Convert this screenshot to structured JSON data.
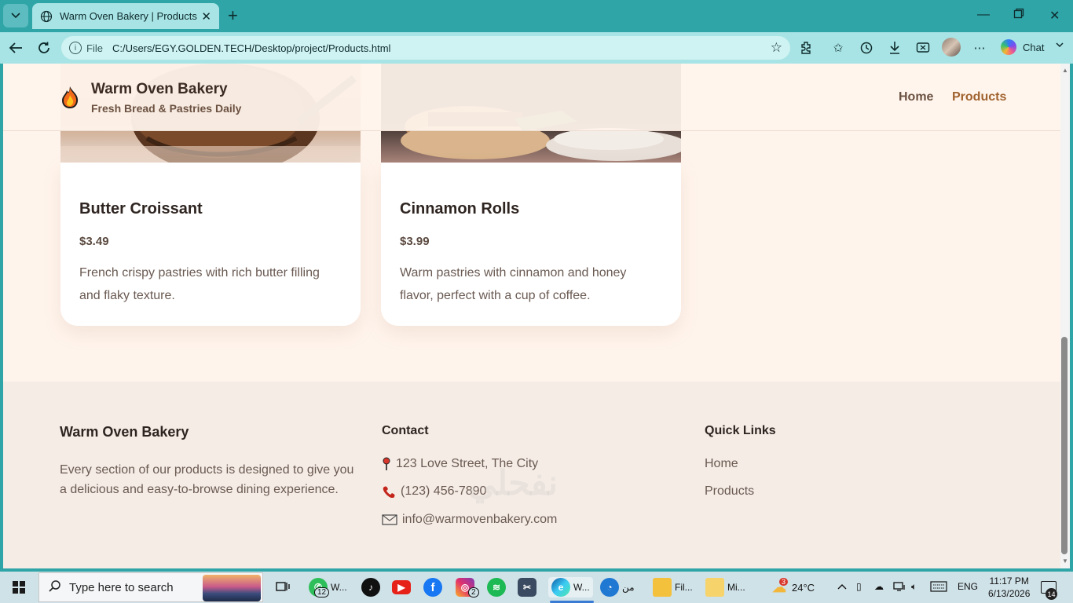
{
  "browser": {
    "tab_title": "Warm Oven Bakery | Products",
    "address_scheme": "File",
    "address_url": "C:/Users/EGY.GOLDEN.TECH/Desktop/project/Products.html",
    "chat_label": "Chat",
    "tab_bg": "#a8e4e5",
    "frame_bg": "#2fa5a8"
  },
  "site": {
    "brand_name": "Warm Oven Bakery",
    "brand_tagline": "Fresh Bread & Pastries Daily",
    "nav": [
      {
        "label": "Home",
        "active": false,
        "color": "#6b5141"
      },
      {
        "label": "Products",
        "active": true,
        "color": "#a0622e"
      }
    ]
  },
  "products": [
    {
      "name": "Butter Croissant",
      "price": "$3.49",
      "description": "French crispy pastries with rich butter filling and flaky texture."
    },
    {
      "name": "Cinnamon Rolls",
      "price": "$3.99",
      "description": "Warm pastries with cinnamon and honey flavor, perfect with a cup of coffee."
    }
  ],
  "footer": {
    "about_title": "Warm Oven Bakery",
    "about_text": "Every section of our products is designed to give you a delicious and easy-to-browse dining experience.",
    "contact_title": "Contact",
    "address": "123 Love Street, The City",
    "phone": "(123) 456-7890",
    "email": "info@warmovenbakery.com",
    "links_title": "Quick Links",
    "links": [
      "Home",
      "Products"
    ]
  },
  "taskbar": {
    "search_placeholder": "Type here to search",
    "whatsapp_label": "W...",
    "whatsapp_badge": "12",
    "instagram_badge": "2",
    "edge_label": "W...",
    "arabic_label": "من",
    "files_label": "Fil...",
    "mi_label": "Mi...",
    "weather_badge": "3",
    "temperature": "24°C",
    "language": "ENG",
    "time": "11:17 PM",
    "date": "6/13/2026",
    "notification_count": "14"
  },
  "watermark": "نفحلي"
}
